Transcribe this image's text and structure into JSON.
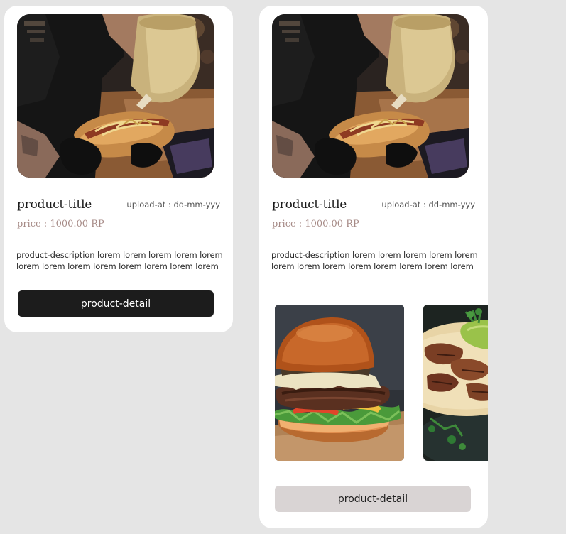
{
  "cards": [
    {
      "title": "product-title",
      "upload_at": "upload-at : dd-mm-yyy",
      "price": "price : 1000.00 RP",
      "description": "product-description lorem lorem lorem lorem lorem lorem lorem lorem lorem lorem lorem lorem lorem",
      "button_label": "product-detail"
    },
    {
      "title": "product-title",
      "upload_at": "upload-at : dd-mm-yyy",
      "price": "price : 1000.00 RP",
      "description": "product-description lorem lorem lorem lorem lorem lorem lorem lorem lorem lorem lorem lorem lorem",
      "button_label": "product-detail"
    }
  ],
  "colors": {
    "background": "#e5e5e5",
    "card": "#ffffff",
    "price_text": "#a68a86",
    "button_dark": "#1c1c1c",
    "button_light": "#d9d4d4"
  }
}
